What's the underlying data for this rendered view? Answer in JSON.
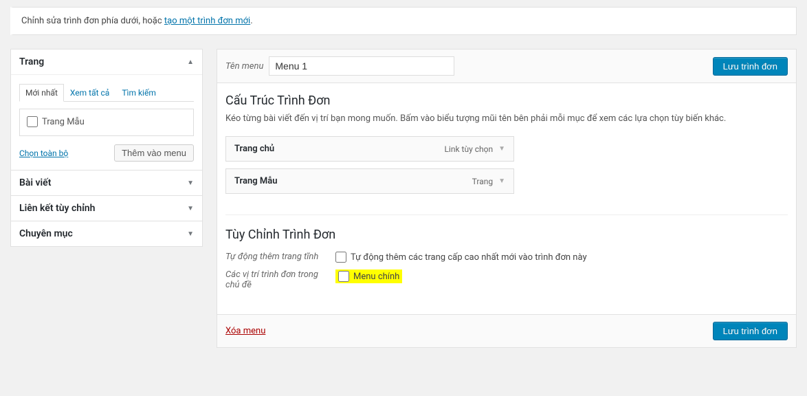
{
  "notice": {
    "text_prefix": "Chỉnh sửa trình đơn phía dưới, hoặc ",
    "link_text": "tạo một trình đơn mới",
    "text_suffix": "."
  },
  "sidebar": {
    "panels": [
      {
        "title": "Trang",
        "expanded": true
      },
      {
        "title": "Bài viết",
        "expanded": false
      },
      {
        "title": "Liên kết tùy chỉnh",
        "expanded": false
      },
      {
        "title": "Chuyên mục",
        "expanded": false
      }
    ],
    "page_panel": {
      "tabs": [
        {
          "label": "Mới nhất",
          "active": true
        },
        {
          "label": "Xem tất cả",
          "active": false
        },
        {
          "label": "Tìm kiếm",
          "active": false
        }
      ],
      "items": [
        {
          "label": "Trang Mẫu"
        }
      ],
      "select_all": "Chọn toàn bộ",
      "add_button": "Thêm vào menu"
    }
  },
  "menu": {
    "name_label": "Tên menu",
    "name_value": "Menu 1",
    "save_button": "Lưu trình đơn",
    "structure_title": "Cấu Trúc Trình Đơn",
    "structure_desc": "Kéo từng bài viết đến vị trí bạn mong muốn. Bấm vào biểu tượng mũi tên bên phải mỗi mục để xem các lựa chọn tùy biến khác.",
    "items": [
      {
        "title": "Trang chủ",
        "type": "Link tùy chọn"
      },
      {
        "title": "Trang Mẫu",
        "type": "Trang"
      }
    ],
    "settings_title": "Tùy Chỉnh Trình Đơn",
    "auto_add_label": "Tự động thêm trang tĩnh",
    "auto_add_desc": "Tự động thêm các trang cấp cao nhất mới vào trình đơn này",
    "locations_label": "Các vị trí trình đơn trong chủ đề",
    "locations_option": "Menu chính",
    "delete_link": "Xóa menu"
  }
}
